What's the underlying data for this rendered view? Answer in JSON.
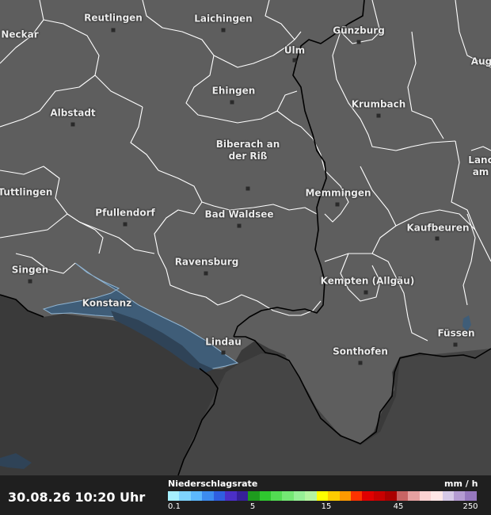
{
  "timestamp": "30.08.26 10:20 Uhr",
  "legend": {
    "title": "Niederschlagsrate",
    "unit": "mm / h",
    "ticks": [
      "0.1",
      "5",
      "15",
      "45",
      "250"
    ],
    "colors": [
      "#a6f0ff",
      "#7fd4ff",
      "#5cb8ff",
      "#3c8cf0",
      "#2f5ee0",
      "#4b2fc8",
      "#36209a",
      "#1e9b1e",
      "#2fc82f",
      "#52dc52",
      "#74e874",
      "#96f096",
      "#b4f5a0",
      "#ffff00",
      "#ffcc00",
      "#ff9900",
      "#ff3300",
      "#e00000",
      "#c80000",
      "#aa0000",
      "#c86464",
      "#e6a0a0",
      "#fad2d2",
      "#ffe6e6",
      "#d6c8e6",
      "#b49bd2",
      "#9678be"
    ]
  },
  "cities": [
    {
      "name": "Reutlingen",
      "id": "reutlingen"
    },
    {
      "name": "Laichingen",
      "id": "laichingen"
    },
    {
      "name": "Neckar",
      "id": "neckar"
    },
    {
      "name": "Günzburg",
      "id": "guenzburg"
    },
    {
      "name": "Ulm",
      "id": "ulm"
    },
    {
      "name": "Aug",
      "id": "augsburg"
    },
    {
      "name": "Ehingen",
      "id": "ehingen"
    },
    {
      "name": "Albstadt",
      "id": "albstadt"
    },
    {
      "name": "Krumbach",
      "id": "krumbach"
    },
    {
      "name": "Biberach an\nder Riß",
      "id": "biberach"
    },
    {
      "name": "Lanc\nam",
      "id": "landsberg"
    },
    {
      "name": "Tuttlingen",
      "id": "tuttlingen"
    },
    {
      "name": "Memmingen",
      "id": "memmingen"
    },
    {
      "name": "Pfullendorf",
      "id": "pfullendorf"
    },
    {
      "name": "Bad Waldsee",
      "id": "badwaldsee"
    },
    {
      "name": "Kaufbeuren",
      "id": "kaufbeuren"
    },
    {
      "name": "Ravensburg",
      "id": "ravensburg"
    },
    {
      "name": "Singen",
      "id": "singen"
    },
    {
      "name": "Kempten (Allgäu)",
      "id": "kempten"
    },
    {
      "name": "Konstanz",
      "id": "konstanz"
    },
    {
      "name": "Füssen",
      "id": "fuessen"
    },
    {
      "name": "Lindau",
      "id": "lindau"
    },
    {
      "name": "Sonthofen",
      "id": "sonthofen"
    }
  ]
}
